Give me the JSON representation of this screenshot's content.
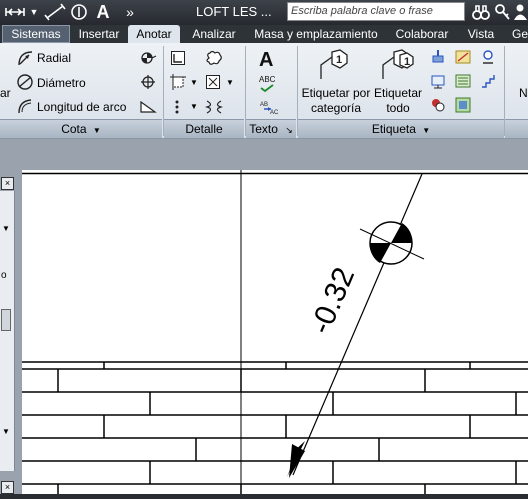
{
  "titlebar": {
    "title": "LOFT LES ...",
    "search_placeholder": "Escriba palabra clave o frase",
    "text_style_glyph": "A",
    "overflow_glyph": "»"
  },
  "tabs": [
    "Sistemas",
    "Insertar",
    "Anotar",
    "Analizar",
    "Masa y emplazamiento",
    "Colaborar",
    "Vista",
    "Ge"
  ],
  "active_tab": "Anotar",
  "ribbon": {
    "cota": {
      "items": [
        "Radial",
        "Diámetro",
        "Longitud de arco"
      ],
      "clipped_item": "ar",
      "footer": "Cota"
    },
    "detalle": {
      "footer": "Detalle"
    },
    "texto": {
      "big_glyph": "A",
      "spell_glyph": "ABC",
      "footer": "Texto"
    },
    "etiqueta": {
      "buttons": [
        "Etiquetar por categoría",
        "Etiquetar todo"
      ],
      "tag_number": "1",
      "clipped_item": "N",
      "footer": "Etiqueta"
    }
  },
  "palette": {
    "close_glyph": "×",
    "clipped_letter": "o"
  },
  "drawing": {
    "elevation_label": "-0.32"
  },
  "colors": {
    "titlebar": "#2a2e33",
    "ribbon": "#e4e9ef",
    "active_tab": "#dfe5ec",
    "canvas": "#ffffff",
    "view_background": "#9aa3ad"
  }
}
